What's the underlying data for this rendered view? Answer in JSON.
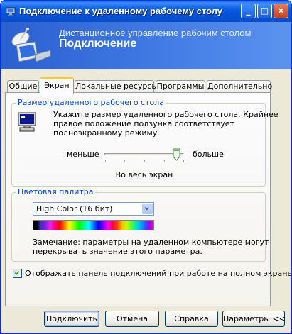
{
  "window": {
    "title": "Подключение к удаленному рабочему столу",
    "controls": {
      "minimize": "_",
      "maximize": "□",
      "close": "×"
    }
  },
  "banner": {
    "subtitle": "Дистанционное управление рабочим столом",
    "title": "Подключение"
  },
  "tabs": [
    {
      "label": "Общие",
      "active": false
    },
    {
      "label": "Экран",
      "active": true
    },
    {
      "label": "Локальные ресурсы",
      "active": false
    },
    {
      "label": "Программы",
      "active": false
    },
    {
      "label": "Дополнительно",
      "active": false
    }
  ],
  "screen_size": {
    "group_title": "Размер удаленного рабочего стола",
    "description": [
      "Укажите размер удаленного рабочего стола. Крайнее",
      "правое положение ползунка соответствует",
      "полноэкранному режиму."
    ],
    "less_label": "меньше",
    "more_label": "больше",
    "slider_position": 0.95,
    "value_label": "Во весь экран"
  },
  "color_palette": {
    "group_title": "Цветовая палитра",
    "selected": "High Color (16 бит)",
    "note": [
      "Замечание: параметры на удаленном компьютере могут",
      "перекрывать значение этого параметра."
    ]
  },
  "fullscreen_bar": {
    "label": "Отображать панель подключений при работе на полном экране",
    "checked": true
  },
  "buttons": {
    "connect": "Подключить",
    "cancel": "Отмена",
    "help": "Справка",
    "options": "Параметры <<"
  },
  "colors": {
    "accent": "#0046D5",
    "titlebar": "#0A5AE0",
    "face": "#ECE9D8"
  }
}
